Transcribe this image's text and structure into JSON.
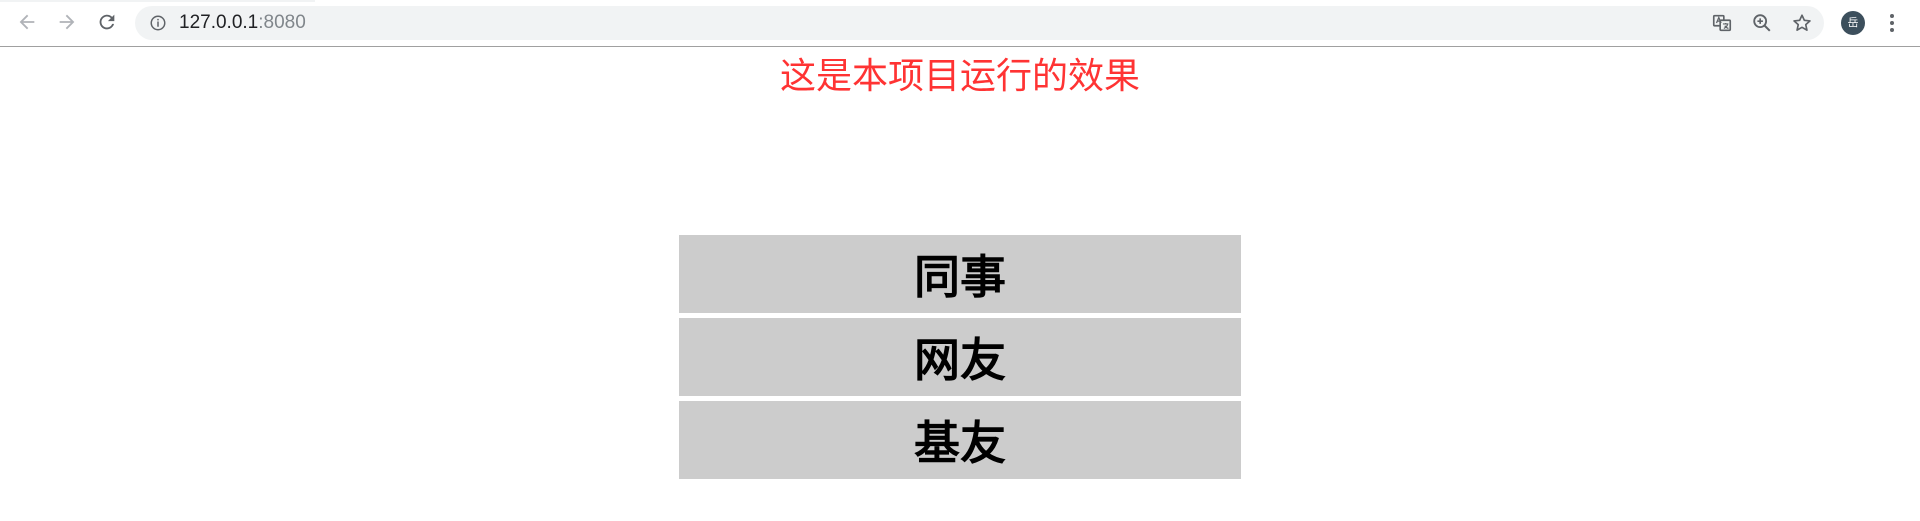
{
  "browser": {
    "url_host": "127.0.0.1",
    "url_port": ":8080",
    "profile_initial": "岳"
  },
  "page": {
    "heading": "这是本项目运行的效果",
    "heading_color": "#ff3333",
    "items": [
      {
        "label": "同事"
      },
      {
        "label": "网友"
      },
      {
        "label": "基友"
      }
    ],
    "item_background": "#cccccc"
  },
  "icons": {
    "back": "arrow-left-icon",
    "forward": "arrow-right-icon",
    "reload": "reload-icon",
    "site_info": "info-icon",
    "translate": "translate-icon",
    "zoom": "zoom-in-icon",
    "bookmark": "star-icon",
    "menu": "kebab-menu-icon"
  }
}
